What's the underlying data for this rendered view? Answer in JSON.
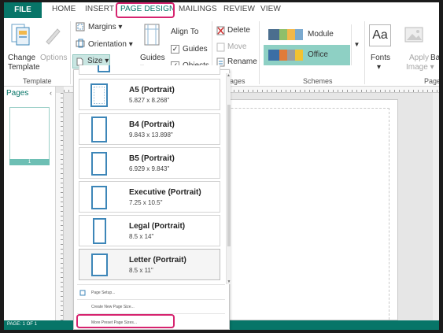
{
  "tabs": {
    "file": "FILE",
    "home": "HOME",
    "insert": "INSERT",
    "page_design": "PAGE DESIGN",
    "mailings": "MAILINGS",
    "review": "REVIEW",
    "view": "VIEW"
  },
  "ribbon": {
    "change_template_1": "Change",
    "change_template_2": "Template",
    "options": "Options",
    "template_group": "Template",
    "margins": "Margins",
    "orientation": "Orientation",
    "size": "Size",
    "guides_btn": "Guides",
    "align_to": "Align To",
    "guides_chk": "Guides",
    "objects_chk": "Objects",
    "delete": "Delete",
    "move": "Move",
    "rename": "Rename",
    "pages_group": "ages",
    "scheme_module": "Module",
    "scheme_office": "Office",
    "schemes_group": "Schemes",
    "fonts": "Fonts",
    "apply_image_1": "Apply",
    "apply_image_2": "Image",
    "background_trunc": "Ba",
    "page_group_trunc": "Page"
  },
  "pages_pane": {
    "title": "Pages",
    "thumb_number": "1"
  },
  "size_dropdown": {
    "items": [
      {
        "name": "A5 (Portrait)",
        "dims": "5.827 x 8.268\""
      },
      {
        "name": "B4 (Portrait)",
        "dims": "9.843 x 13.898\""
      },
      {
        "name": "B5 (Portrait)",
        "dims": "6.929 x 9.843\""
      },
      {
        "name": "Executive (Portrait)",
        "dims": "7.25 x 10.5\""
      },
      {
        "name": "Legal (Portrait)",
        "dims": "8.5 x 14\""
      },
      {
        "name": "Letter (Portrait)",
        "dims": "8.5 x 11\""
      }
    ],
    "page_setup": "Page Setup...",
    "create_new": "Create New Page Size...",
    "more_preset": "More Preset Page Sizes..."
  },
  "status": {
    "page": "PAGE: 1 OF 1"
  },
  "colors": {
    "accent": "#077568",
    "highlight": "#d6246f",
    "paper_icon": "#3d86b8"
  }
}
